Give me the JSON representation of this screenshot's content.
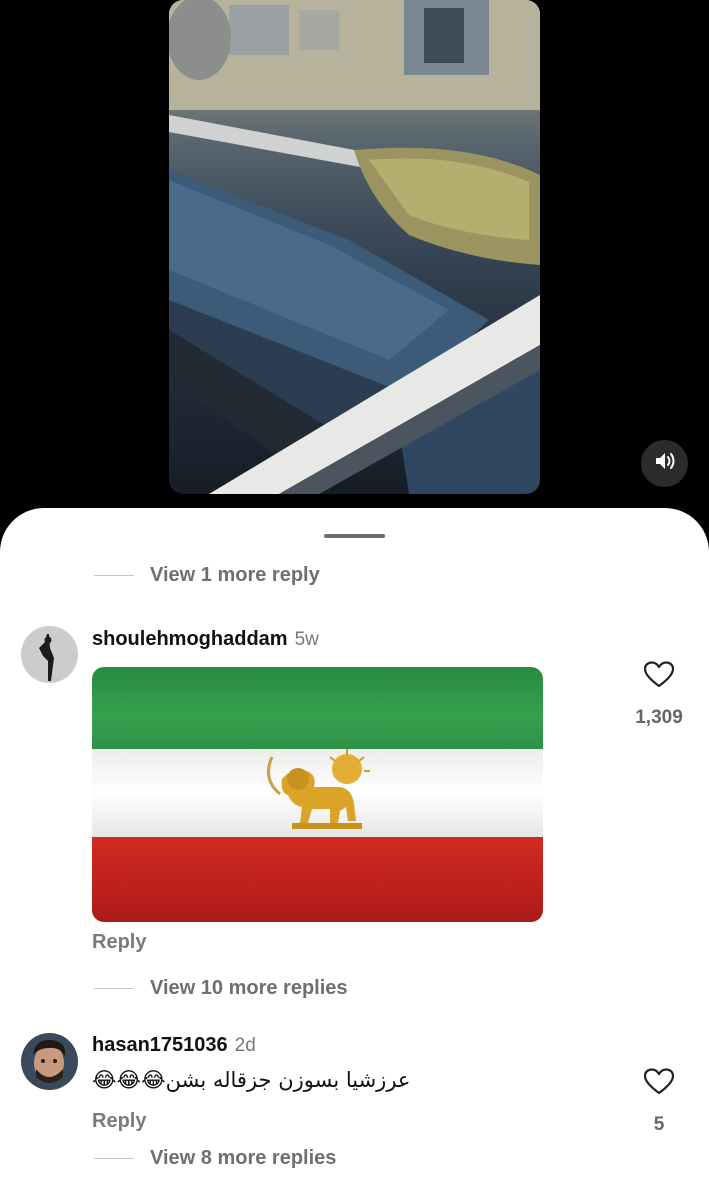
{
  "video": {
    "mute_icon": "speaker-icon"
  },
  "comments": {
    "view_more_top": "View 1 more reply",
    "items": [
      {
        "username": "shoulehmoghaddam",
        "time": "5w",
        "media": "iran-lion-and-sun-flag",
        "reply_label": "Reply",
        "like_count": "1,309",
        "view_more": "View 10 more replies"
      },
      {
        "username": "hasan1751036",
        "time": "2d",
        "text": "عرزشیا بسوزن جزقاله بشن😂😂😂",
        "reply_label": "Reply",
        "like_count": "5",
        "view_more": "View 8 more replies"
      }
    ]
  },
  "colors": {
    "flag_green": "#2f9146",
    "flag_white": "#f2f2f0",
    "flag_red": "#c8231f",
    "emblem_gold": "#d9a428"
  }
}
